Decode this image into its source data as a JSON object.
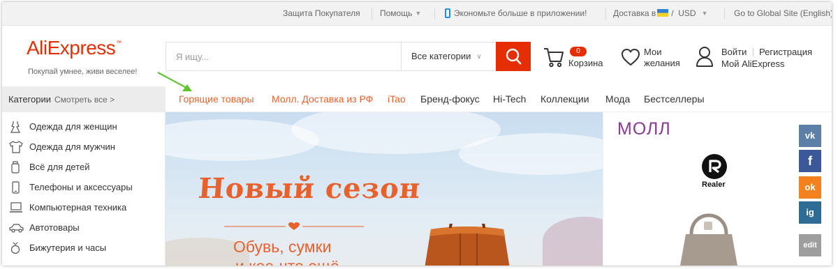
{
  "topbar": {
    "buyer_protection": "Защита Покупателя",
    "help": "Помощь",
    "app_promo": "Экономьте больше в приложении!",
    "delivery_label": "Доставка в",
    "currency_sep": "/",
    "currency": "USD",
    "global_site": "Go to Global Site (English)"
  },
  "logo": {
    "text_ali": "Ali",
    "text_express": "Express",
    "tm": "™",
    "tagline": "Покупай умнее, живи веселее!"
  },
  "search": {
    "placeholder": "Я ищу...",
    "category": "Все категории"
  },
  "cart": {
    "count": "0",
    "label": "Корзина"
  },
  "wishlist": {
    "line1": "Мои",
    "line2": "желания"
  },
  "account": {
    "login": "Войти",
    "register": "Регистрация",
    "my": "Мой AliExpress"
  },
  "categories_header": {
    "title": "Категории",
    "see_all": "Смотреть все >"
  },
  "nav": {
    "items": [
      {
        "label": "Горящие товары",
        "hot": true
      },
      {
        "label": "Молл. Доставка из РФ",
        "hot": true
      },
      {
        "label": "iTao",
        "hot": true
      },
      {
        "label": "Бренд-фокус",
        "hot": false
      },
      {
        "label": "Hi-Tech",
        "hot": false
      },
      {
        "label": "Коллекции",
        "hot": false
      },
      {
        "label": "Мода",
        "hot": false
      },
      {
        "label": "Бестселлеры",
        "hot": false
      }
    ]
  },
  "sidebar": {
    "items": [
      {
        "label": "Одежда для женщин",
        "icon": "dress-icon"
      },
      {
        "label": "Одежда для мужчин",
        "icon": "shirt-icon"
      },
      {
        "label": "Всё для детей",
        "icon": "bottle-icon"
      },
      {
        "label": "Телефоны и аксессуары",
        "icon": "phone-icon"
      },
      {
        "label": "Компьютерная техника",
        "icon": "computer-icon"
      },
      {
        "label": "Автотовары",
        "icon": "car-icon"
      },
      {
        "label": "Бижутерия и часы",
        "icon": "ring-icon"
      }
    ]
  },
  "banner": {
    "title": "Новый сезон",
    "subtitle": "Обувь, сумки",
    "subtitle2": "и кое-что ещё"
  },
  "mall": {
    "title": "МОЛЛ",
    "brand": "Realer"
  },
  "social": {
    "vk": "vk",
    "facebook": "f",
    "odnoklassniki": "ok",
    "instagram": "ig",
    "edit": "edit"
  },
  "colors": {
    "brand": "#e62e04",
    "hot_link": "#e8612c",
    "mall": "#8a3a96",
    "vk": "#5b7fa6",
    "facebook": "#3b5998",
    "odnoklassniki": "#f4811f",
    "instagram": "#2e6c95"
  }
}
